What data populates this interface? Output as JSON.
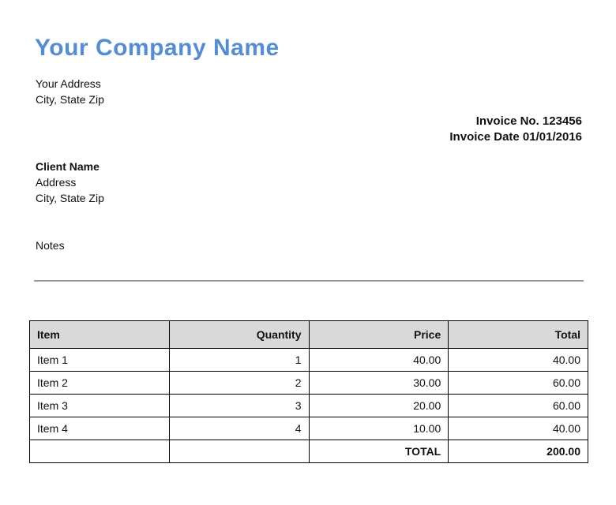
{
  "company": {
    "name": "Your Company Name",
    "address_line1": "Your Address",
    "address_line2": "City, State Zip"
  },
  "invoice_meta": {
    "number_line": "Invoice No. 123456",
    "date_line": "Invoice Date 01/01/2016"
  },
  "client": {
    "name": "Client Name",
    "address_line1": "Address",
    "address_line2": "City, State Zip"
  },
  "notes_label": "Notes",
  "colors": {
    "company_name_accent": "#548DD4",
    "table_header_bg": "#d9d9d9",
    "table_border": "#000000",
    "divider": "#8e8e8e",
    "page_bg": "#ffffff"
  },
  "table": {
    "headers": [
      "Item",
      "Quantity",
      "Price",
      "Total"
    ],
    "rows": [
      {
        "item": "Item 1",
        "quantity": "1",
        "price": "40.00",
        "total": "40.00"
      },
      {
        "item": "Item 2",
        "quantity": "2",
        "price": "30.00",
        "total": "60.00"
      },
      {
        "item": "Item 3",
        "quantity": "3",
        "price": "20.00",
        "total": "60.00"
      },
      {
        "item": "Item 4",
        "quantity": "4",
        "price": "10.00",
        "total": "40.00"
      }
    ],
    "total_label": "TOTAL",
    "total_value": "200.00"
  }
}
